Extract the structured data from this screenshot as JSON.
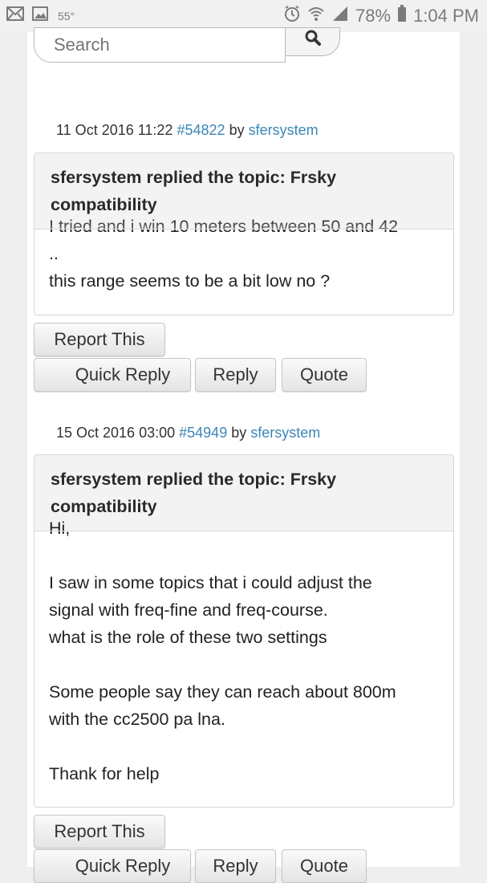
{
  "status_bar": {
    "temperature": "55°",
    "battery_percent": "78%",
    "time": "1:04 PM"
  },
  "search": {
    "placeholder": "Search"
  },
  "posts": [
    {
      "date": "11 Oct 2016 11:22",
      "post_id": "#54822",
      "by_label": "by",
      "author": "sfersystem",
      "title": "sfersystem replied the topic: Frsky compatibility",
      "body": "I tried and i win 10 meters between 50 and 42\n..\nthis range seems to be a bit low no ?",
      "buttons": {
        "report": "Report This",
        "quick_reply": "Quick Reply",
        "reply": "Reply",
        "quote": "Quote"
      }
    },
    {
      "date": "15 Oct 2016 03:00",
      "post_id": "#54949",
      "by_label": "by",
      "author": "sfersystem",
      "title": "sfersystem replied the topic: Frsky compatibility",
      "body": "Hi,\n\nI saw in some topics that i could adjust the\nsignal with freq-fine and freq-course.\nwhat is the role of these two settings\n\nSome people say they can reach about 800m\nwith the cc2500 pa lna.\n\nThank for help",
      "buttons": {
        "report": "Report This",
        "quick_reply": "Quick Reply",
        "reply": "Reply",
        "quote": "Quote"
      }
    }
  ],
  "colors": {
    "link": "#3b87b5",
    "page_bg": "#ffffff",
    "outer_bg": "#efefef"
  }
}
